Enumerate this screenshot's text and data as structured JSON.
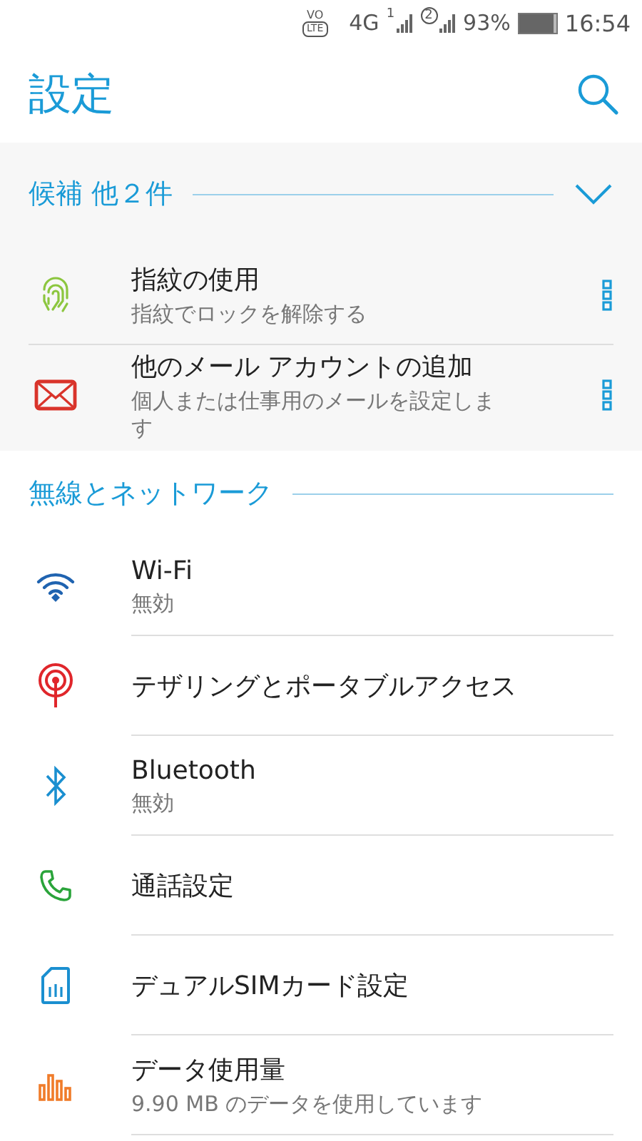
{
  "status_bar": {
    "volte_top": "VO",
    "volte_bottom": "LTE",
    "network": "4G",
    "sim1": "1",
    "sim2": "2",
    "battery": "93%",
    "time": "16:54"
  },
  "header": {
    "title": "設定"
  },
  "suggestions": {
    "title": "候補  他２件",
    "items": [
      {
        "title": "指紋の使用",
        "subtitle": "指紋でロックを解除する"
      },
      {
        "title": "他のメール アカウントの追加",
        "subtitle": "個人または仕事用のメールを設定します"
      }
    ]
  },
  "sections": [
    {
      "title": "無線とネットワーク",
      "items": [
        {
          "title": "Wi-Fi",
          "subtitle": "無効"
        },
        {
          "title": "テザリングとポータブルアクセス"
        },
        {
          "title": "Bluetooth",
          "subtitle": "無効"
        },
        {
          "title": "通話設定"
        },
        {
          "title": "デュアルSIMカード設定"
        },
        {
          "title": "データ使用量",
          "subtitle": "9.90 MB のデータを使用しています"
        }
      ]
    }
  ]
}
